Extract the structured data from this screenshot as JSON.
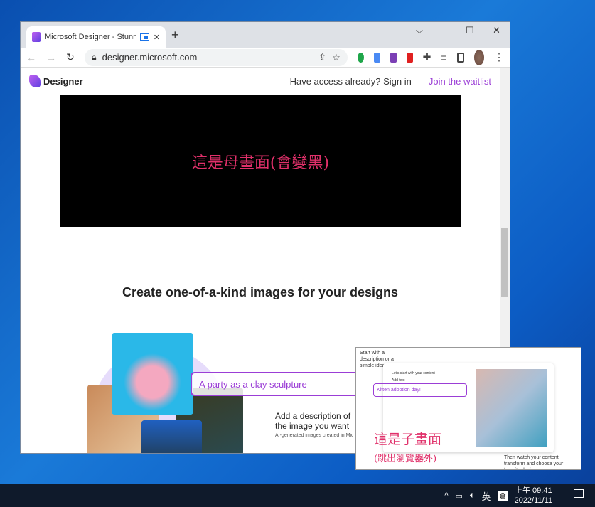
{
  "browser": {
    "tab_title": "Microsoft Designer - Stunning",
    "url": "designer.microsoft.com",
    "new_tab": "+",
    "window": {
      "dropdown": "⌵",
      "minimize": "–",
      "maximize": "☐",
      "close": "✕"
    },
    "nav": {
      "back": "←",
      "forward": "→",
      "reload": "↻"
    }
  },
  "header": {
    "logo": "Designer",
    "sign_in": "Have access already? Sign in",
    "waitlist": "Join the waitlist"
  },
  "video": {
    "annotation": "這是母畫面(會變黑)"
  },
  "main": {
    "heading": "Create one-of-a-kind images for your designs",
    "prompt": "A party as a clay sculpture",
    "description": "Add a description of the image you want to create, and we'll generate it",
    "caption": "AI-generated images created in Microsoft Designer"
  },
  "pip": {
    "note_top": "Start with a description or a simple idea",
    "card_title": "Let's start with your content",
    "add_text": "Add text",
    "input": "Kitten adoption day!",
    "annotation": "這是子畫面",
    "annotation_sub": "(跳出瀏覽器外)",
    "note_bottom": "Then watch your content transform and choose your favorite design"
  },
  "taskbar": {
    "ime": "英",
    "time": "上午 09:41",
    "date": "2022/11/11",
    "chevron": "^"
  },
  "colors": {
    "accent": "#9b3ed6",
    "annotation": "#e0306a"
  }
}
